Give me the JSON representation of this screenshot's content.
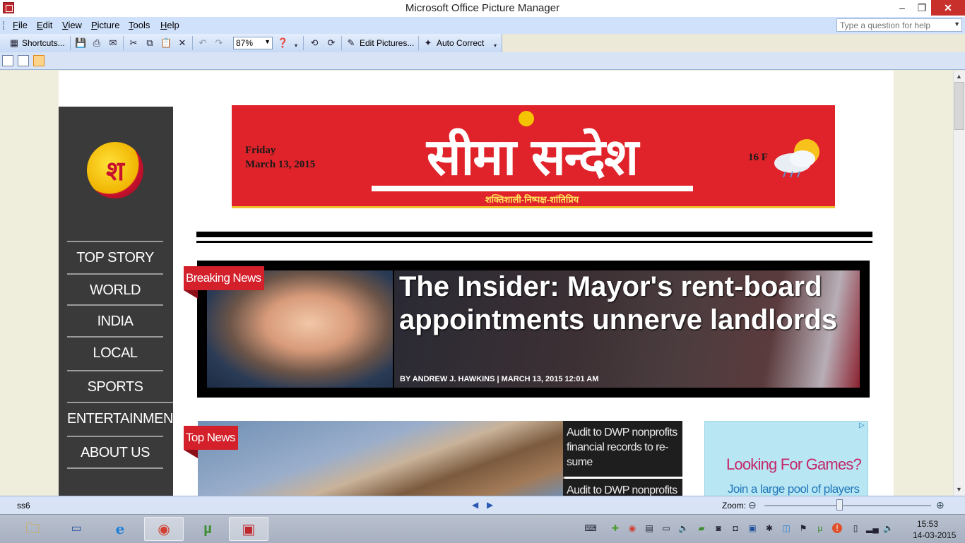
{
  "window": {
    "title": "Microsoft Office Picture Manager"
  },
  "menu": [
    "File",
    "Edit",
    "View",
    "Picture",
    "Tools",
    "Help"
  ],
  "help_box": {
    "placeholder": "Type a question for help"
  },
  "toolbar": {
    "shortcuts_label": "Shortcuts...",
    "zoom_value": "87%",
    "edit_pictures_label": "Edit Pictures...",
    "auto_correct_label": "Auto Correct"
  },
  "picture": {
    "masthead": {
      "day": "Friday",
      "date": "March 13, 2015",
      "name": "सीमा सन्देश",
      "tagline": "शक्तिशाली-निष्पक्ष-शांतिप्रिय",
      "temperature": "16 F",
      "logo_glyph": "श",
      "colors": {
        "red": "#e0232a",
        "accent": "#f2c12e"
      }
    },
    "nav": [
      "TOP STORY",
      "WORLD",
      "INDIA",
      "LOCAL",
      "SPORTS",
      "ENTERTAINMENT",
      "ABOUT US"
    ],
    "breaking": {
      "label": "Breaking News",
      "headline": "The Insider: Mayor's rent-board appointments unnerve landlords",
      "byline": "BY ANDREW J. HAWKINS | MARCH 13, 2015 12:01 AM"
    },
    "top_news": {
      "label": "Top News",
      "items": [
        "Audit to DWP nonprofits financial records to re-sume",
        "Audit to DWP nonprofits"
      ]
    },
    "ad": {
      "title": "Looking For Games?",
      "subtitle": "Join a large pool of players"
    }
  },
  "status": {
    "filename": "ss6",
    "zoom_label": "Zoom:",
    "zoom_level": 0.45
  },
  "taskbar": {
    "apps": [
      "file-explorer",
      "lenovo",
      "internet-explorer",
      "chrome",
      "utorrent",
      "picture-manager"
    ],
    "time": "15:53",
    "date": "14-03-2015"
  }
}
